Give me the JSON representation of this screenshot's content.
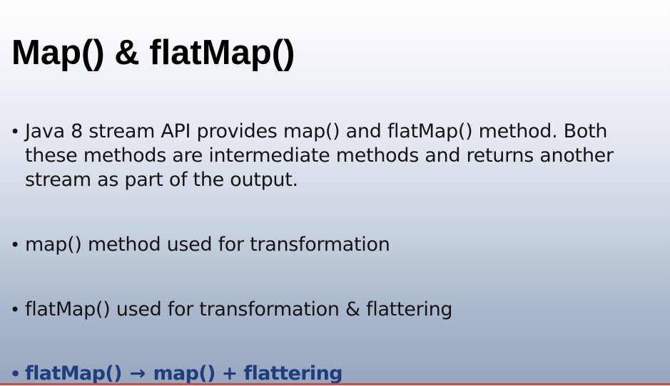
{
  "slide": {
    "title": "Map() & flatMap()",
    "bullets": [
      {
        "lines": [
          "Java 8 stream API provides map() and flatMap() method. Both",
          "these methods are intermediate methods and returns another",
          "stream as part of the output."
        ]
      },
      {
        "text": "map() method used for transformation"
      },
      {
        "text": "flatMap() used for transformation & flattering"
      },
      {
        "left": "flatMap()",
        "arrow": "→",
        "right": "map() + flattering",
        "color": "#1f3d7a"
      }
    ],
    "bullet_glyph": "•"
  }
}
